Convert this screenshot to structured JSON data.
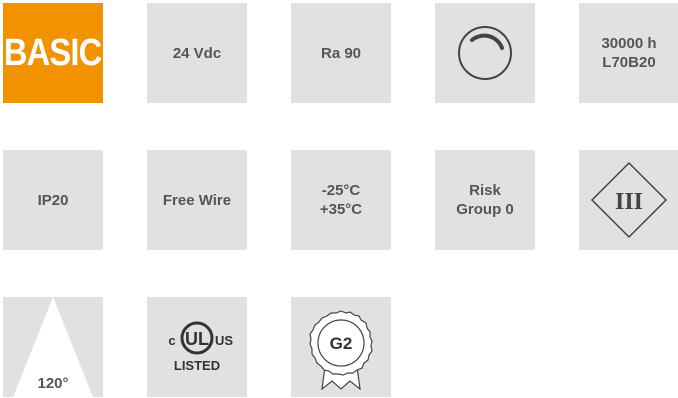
{
  "tiles": {
    "basic": "BASIC",
    "voltage": "24 Vdc",
    "cri": "Ra 90",
    "dimming": "dimming-icon",
    "lifetime_line1": "30000 h",
    "lifetime_line2": "L70B20",
    "ip": "IP20",
    "wire": "Free Wire",
    "temp_line1": "-25°C",
    "temp_line2": "+35°C",
    "risk_line1": "Risk",
    "risk_line2": "Group 0",
    "class_iii": "III",
    "beam_angle": "120°",
    "ul_c": "c",
    "ul_mark": "UL",
    "ul_us": "US",
    "ul_listed": "LISTED",
    "energy_class": "G2"
  },
  "colors": {
    "tile_bg": "#e1e1e1",
    "accent_orange": "#f39200",
    "text": "#555555",
    "icon_stroke": "#444444"
  }
}
